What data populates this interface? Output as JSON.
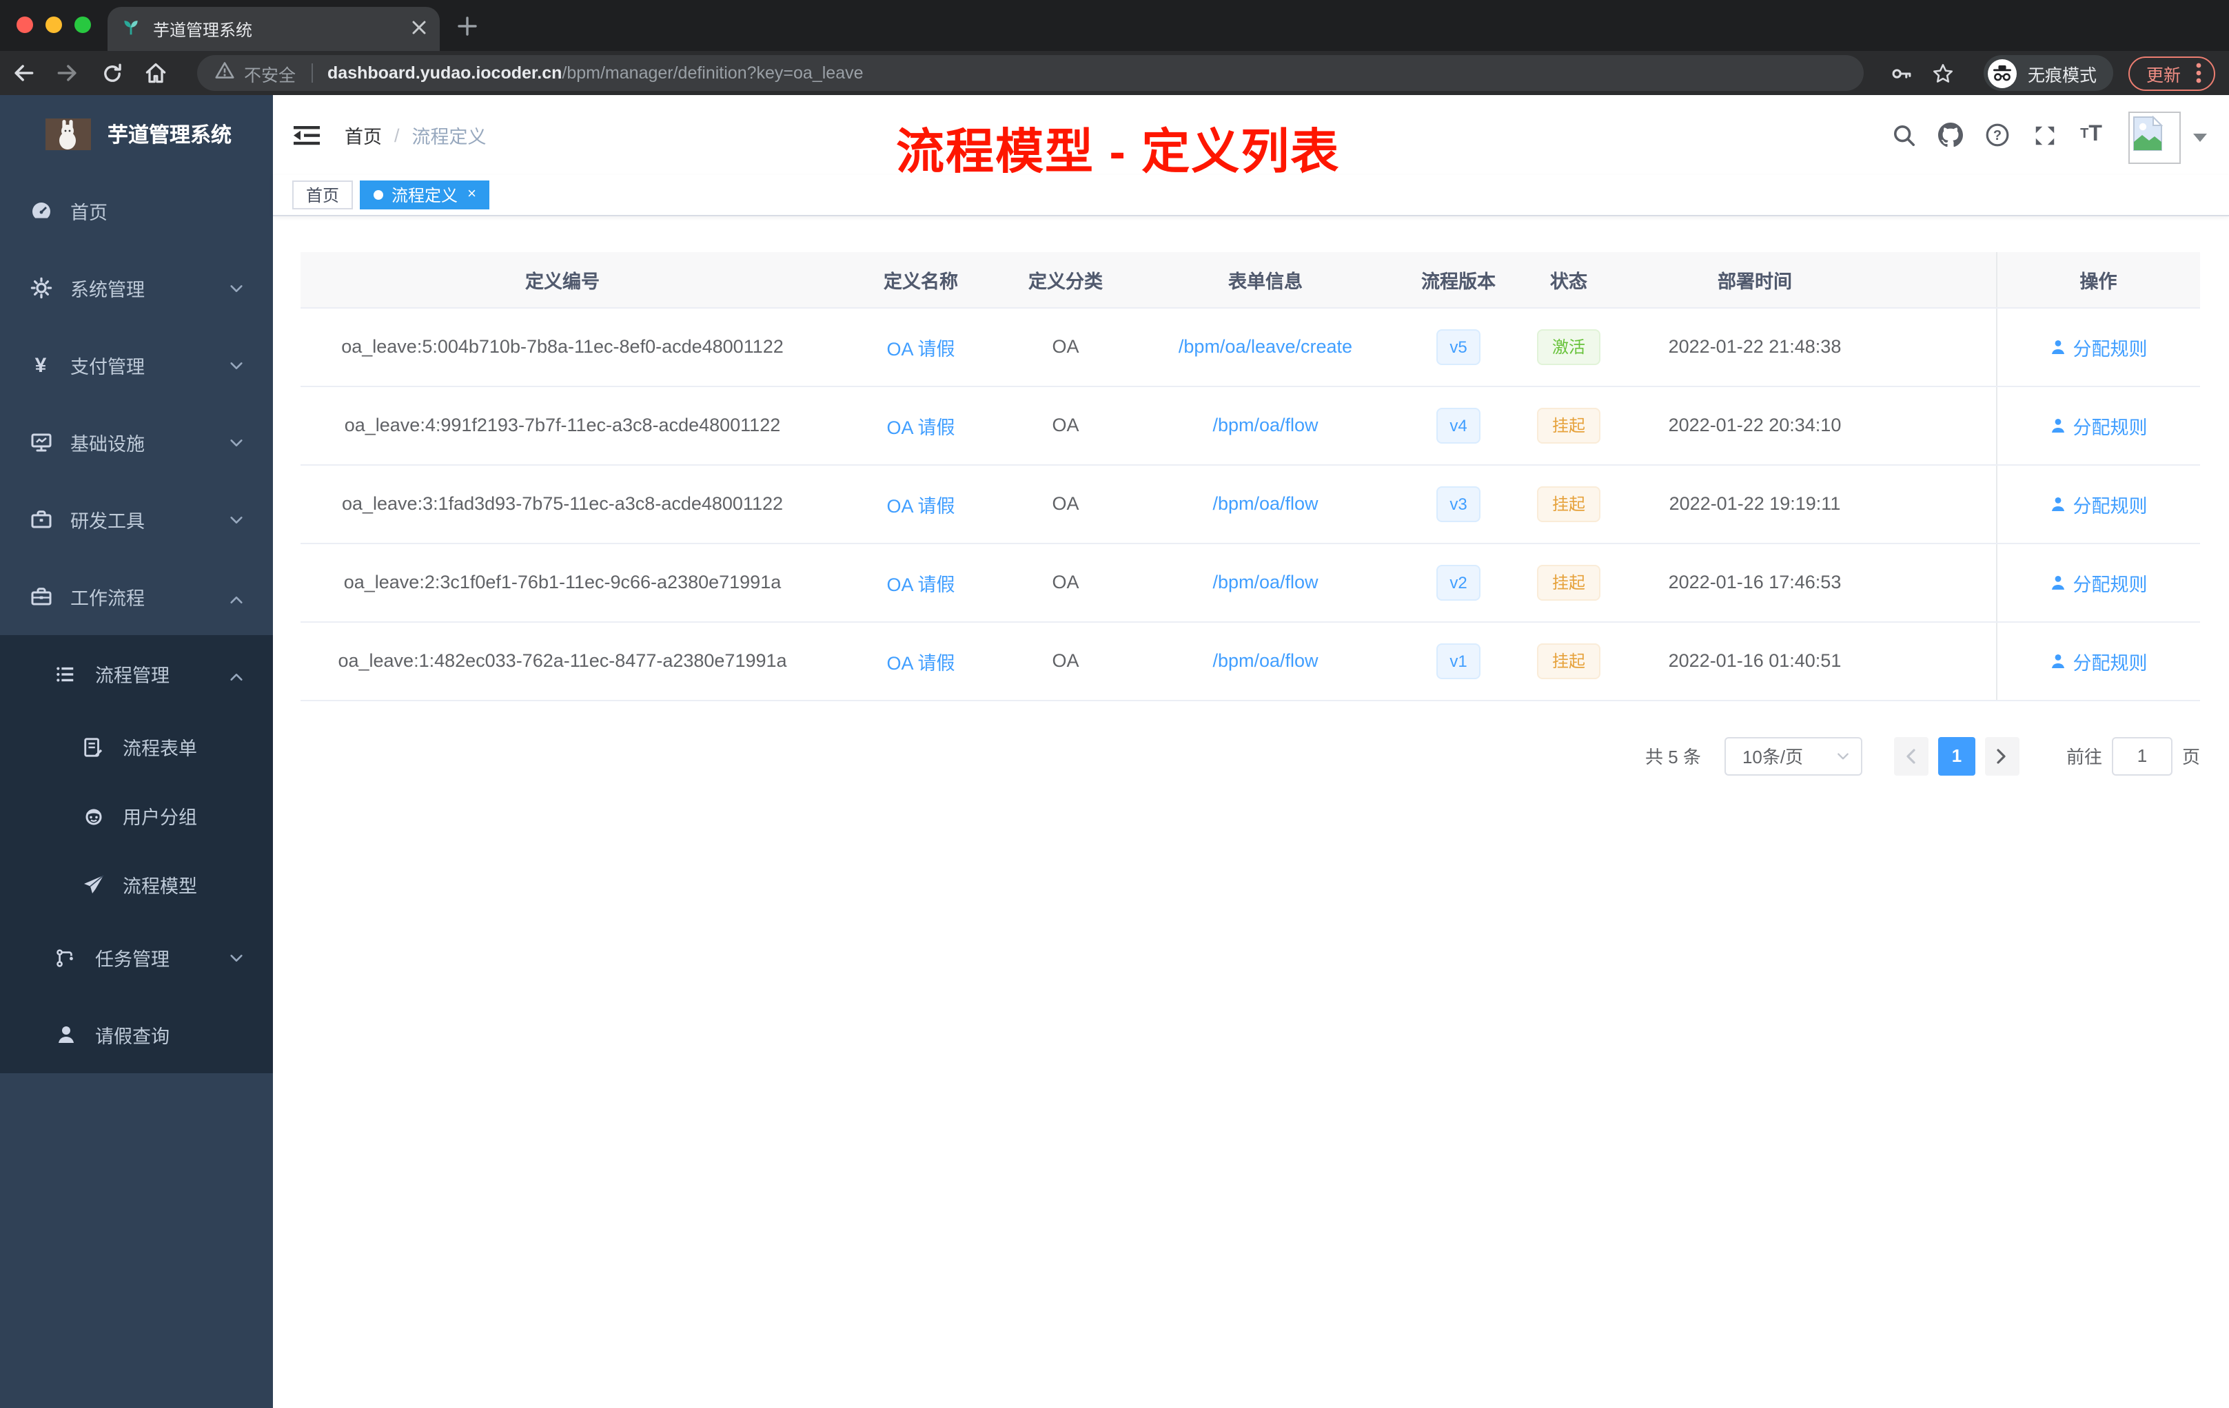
{
  "browser": {
    "tab_title": "芋道管理系统",
    "security_label": "不安全",
    "url_domain": "dashboard.yudao.iocoder.cn",
    "url_path": "/bpm/manager/definition?key=oa_leave",
    "incognito_label": "无痕模式",
    "update_label": "更新"
  },
  "sidebar": {
    "logo_title": "芋道管理系统",
    "items": [
      {
        "label": "首页",
        "icon": "dashboard-icon"
      },
      {
        "label": "系统管理",
        "icon": "gear-icon"
      },
      {
        "label": "支付管理",
        "icon": "yen-icon"
      },
      {
        "label": "基础设施",
        "icon": "monitor-icon"
      },
      {
        "label": "研发工具",
        "icon": "toolbox-icon"
      },
      {
        "label": "工作流程",
        "icon": "briefcase-icon"
      }
    ],
    "workflow_children": [
      {
        "label": "流程管理",
        "icon": "list-icon"
      },
      {
        "label": "流程表单",
        "icon": "form-icon"
      },
      {
        "label": "用户分组",
        "icon": "robot-icon"
      },
      {
        "label": "流程模型",
        "icon": "paper-plane-icon"
      },
      {
        "label": "任务管理",
        "icon": "tree-icon"
      },
      {
        "label": "请假查询",
        "icon": "user-icon"
      }
    ]
  },
  "header": {
    "breadcrumb_home": "首页",
    "breadcrumb_separator": "/",
    "breadcrumb_current": "流程定义",
    "annotation_title": "流程模型 - 定义列表"
  },
  "tags": {
    "home": "首页",
    "active": "流程定义"
  },
  "table": {
    "columns": [
      "定义编号",
      "定义名称",
      "定义分类",
      "表单信息",
      "流程版本",
      "状态",
      "部署时间",
      "操作"
    ],
    "action_label": "分配规则",
    "rows": [
      {
        "id": "oa_leave:5:004b710b-7b8a-11ec-8ef0-acde48001122",
        "name": "OA 请假",
        "category": "OA",
        "form": "/bpm/oa/leave/create",
        "version": "v5",
        "status": "激活",
        "status_type": "success",
        "time": "2022-01-22 21:48:38"
      },
      {
        "id": "oa_leave:4:991f2193-7b7f-11ec-a3c8-acde48001122",
        "name": "OA 请假",
        "category": "OA",
        "form": "/bpm/oa/flow",
        "version": "v4",
        "status": "挂起",
        "status_type": "warning",
        "time": "2022-01-22 20:34:10"
      },
      {
        "id": "oa_leave:3:1fad3d93-7b75-11ec-a3c8-acde48001122",
        "name": "OA 请假",
        "category": "OA",
        "form": "/bpm/oa/flow",
        "version": "v3",
        "status": "挂起",
        "status_type": "warning",
        "time": "2022-01-22 19:19:11"
      },
      {
        "id": "oa_leave:2:3c1f0ef1-76b1-11ec-9c66-a2380e71991a",
        "name": "OA 请假",
        "category": "OA",
        "form": "/bpm/oa/flow",
        "version": "v2",
        "status": "挂起",
        "status_type": "warning",
        "time": "2022-01-16 17:46:53"
      },
      {
        "id": "oa_leave:1:482ec033-762a-11ec-8477-a2380e71991a",
        "name": "OA 请假",
        "category": "OA",
        "form": "/bpm/oa/flow",
        "version": "v1",
        "status": "挂起",
        "status_type": "warning",
        "time": "2022-01-16 01:40:51"
      }
    ]
  },
  "pagination": {
    "total": "共 5 条",
    "page_size": "10条/页",
    "current": "1",
    "goto": "前往",
    "page_unit": "页"
  },
  "colors": {
    "accent": "#409eff",
    "success": "#67c23a",
    "warning": "#e6a23c",
    "sidebar": "#304156",
    "annotation": "#fe1600"
  }
}
